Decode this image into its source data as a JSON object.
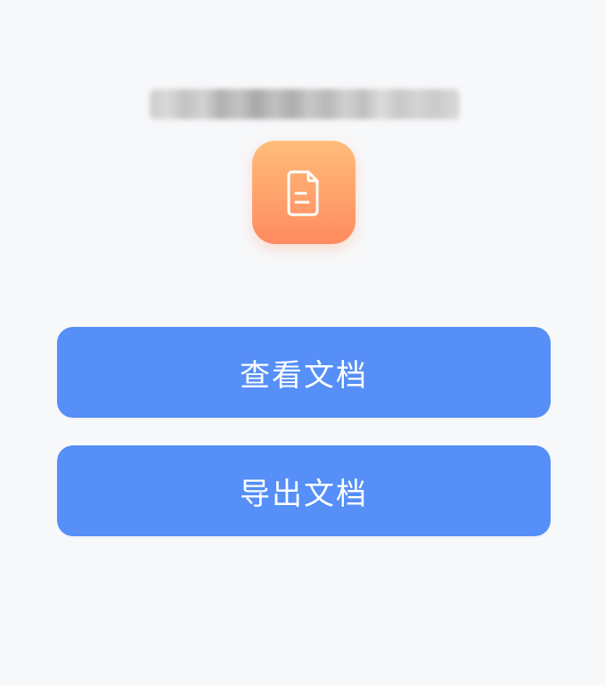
{
  "header": {
    "blurred_title_obscured": true
  },
  "hero": {
    "icon": "document-icon",
    "icon_gradient": [
      "#ffbd7a",
      "#ff8b5f"
    ]
  },
  "actions": {
    "view_label": "查看文档",
    "export_label": "导出文档"
  },
  "colors": {
    "background": "#f7f8fa",
    "primary": "#558ff7",
    "primary_text": "#ffffff"
  }
}
